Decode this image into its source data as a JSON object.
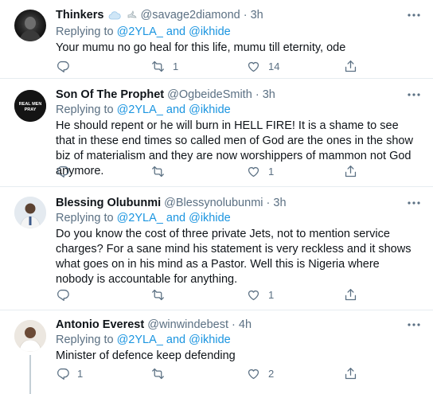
{
  "tweets": [
    {
      "name": "Thinkers",
      "handle": "@savage2diamond",
      "sep": "·",
      "time": "3h",
      "replying_prefix": "Replying to",
      "replying_user1": "@2YLA_",
      "replying_and": "and",
      "replying_user2": "@ikhide",
      "text": "Your mumu no go heal for this life, mumu till eternity, ode",
      "retweets": "1",
      "likes": "14"
    },
    {
      "name": "Son Of The Prophet",
      "handle": "@OgbeideSmith",
      "sep": "·",
      "time": "3h",
      "replying_prefix": "Replying to",
      "replying_user1": "@2YLA_",
      "replying_and": "and",
      "replying_user2": "@ikhide",
      "text": "He should repent or he will burn in HELL FIRE! It is a shame to see that in these end times so called men of God are the ones in the show biz of materialism and they are now worshippers of mammon not God anymore.",
      "retweets": "",
      "likes": "1",
      "avatar_text": "REAL MEN PRAY"
    },
    {
      "name": "Blessing Olubunmi",
      "handle": "@Blessynolubunmi",
      "sep": "·",
      "time": "3h",
      "replying_prefix": "Replying to",
      "replying_user1": "@2YLA_",
      "replying_and": "and",
      "replying_user2": "@ikhide",
      "text": "Do you know the cost of three private Jets, not to mention service charges? For a sane mind his statement is very reckless and it shows what goes on in his mind as a Pastor. Well this is Nigeria where nobody is accountable for anything.",
      "retweets": "",
      "likes": "1"
    },
    {
      "name": "Antonio Everest",
      "handle": "@winwindebest",
      "sep": "·",
      "time": "4h",
      "replying_prefix": "Replying to",
      "replying_user1": "@2YLA_",
      "replying_and": "and",
      "replying_user2": "@ikhide",
      "text": "Minister of defence keep defending",
      "replies": "1",
      "retweets": "",
      "likes": "2"
    }
  ],
  "colors": {
    "link": "#1b95e0",
    "secondary": "#5b7083",
    "divider": "#e6ecf0"
  },
  "icons": [
    "more-icon",
    "reply-icon",
    "retweet-icon",
    "like-icon",
    "share-icon",
    "cloud-emoji",
    "dove-emoji"
  ]
}
